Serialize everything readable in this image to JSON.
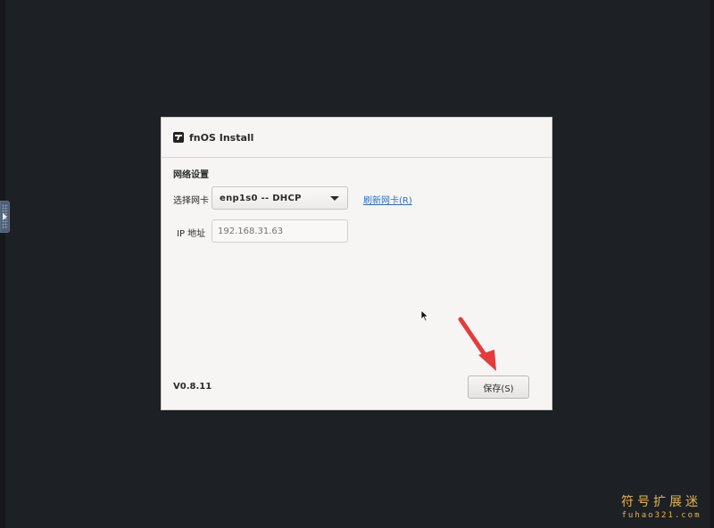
{
  "dialog": {
    "title": "fnOS Install",
    "section_title": "网络设置",
    "nic_label": "选择网卡",
    "nic_selected": "enp1s0 -- DHCP",
    "refresh_link": "刷新网卡(R)",
    "ip_label": "IP 地址",
    "ip_placeholder": "192.168.31.63",
    "version": "V0.8.11",
    "save_label": "保存(S)"
  },
  "watermark": {
    "main": "符号扩展迷",
    "sub": "fuhao321.com"
  },
  "colors": {
    "background": "#1d2025",
    "dialog_bg": "#f6f5f4",
    "link": "#2f6fc6",
    "annotation_arrow": "#e53b3b",
    "watermark": "#e5b54a"
  },
  "icons": {
    "logo": "fnos-logo-icon",
    "dropdown": "caret-down-icon",
    "side_handle": "expand-panel-icon",
    "pointer": "mouse-cursor-icon",
    "annotation": "red-arrow-icon"
  }
}
